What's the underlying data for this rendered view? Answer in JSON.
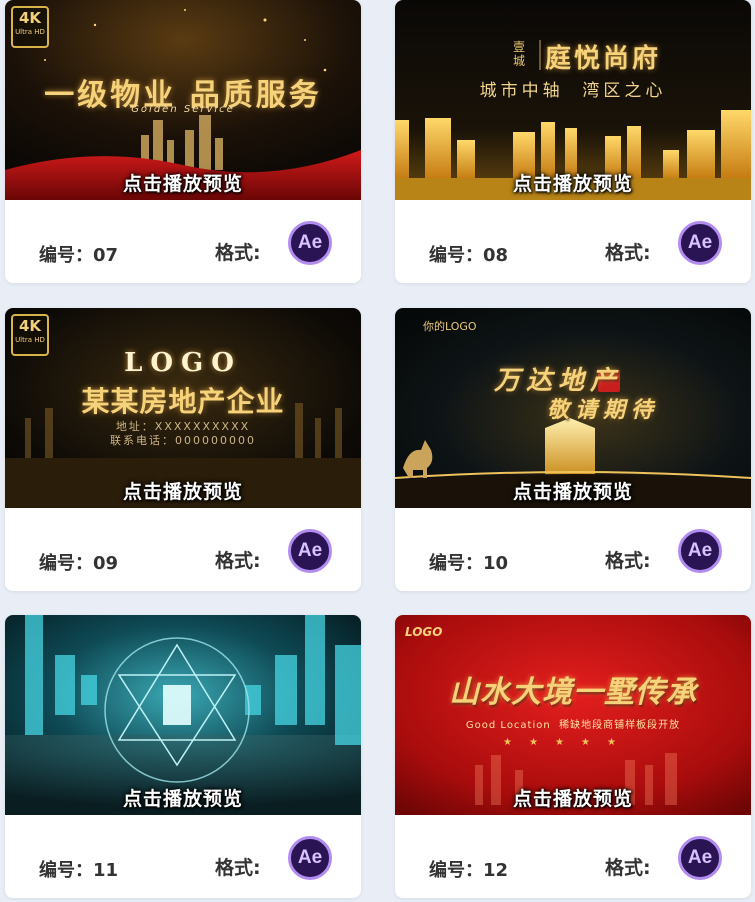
{
  "play_label": "点击播放预览",
  "code_prefix": "编号：",
  "format_label": "格式:",
  "ae_label": "Ae",
  "badge": {
    "k": "4K",
    "u": "Ultra HD"
  },
  "cards": [
    {
      "code": "07",
      "title": "一级物业 品质服务",
      "subtitle": "Golden Service",
      "theme": "red-gold",
      "has_4k": true
    },
    {
      "code": "08",
      "brand_small": "壹城",
      "title": "庭悦尚府",
      "subtitle": "城市中轴  湾区之心",
      "theme": "dark-gold-city",
      "has_4k": false
    },
    {
      "code": "09",
      "logo": "LOGO",
      "title": "某某房地产企业",
      "subtitle": "地址：XXXXXXXXXX",
      "subtitle2": "联系电话：000000000",
      "theme": "black-gold",
      "has_4k": true
    },
    {
      "code": "10",
      "logo": "你的LOGO",
      "title": "万达地产",
      "subtitle": "敬请期待",
      "theme": "dark-horse",
      "has_4k": false
    },
    {
      "code": "11",
      "theme": "cyan-tunnel",
      "has_4k": false
    },
    {
      "code": "12",
      "logo": "LOGO",
      "title": "山水大境一墅传承",
      "subtitle": "Good Location  稀缺地段商铺样板段开放",
      "theme": "red",
      "has_4k": false
    }
  ]
}
